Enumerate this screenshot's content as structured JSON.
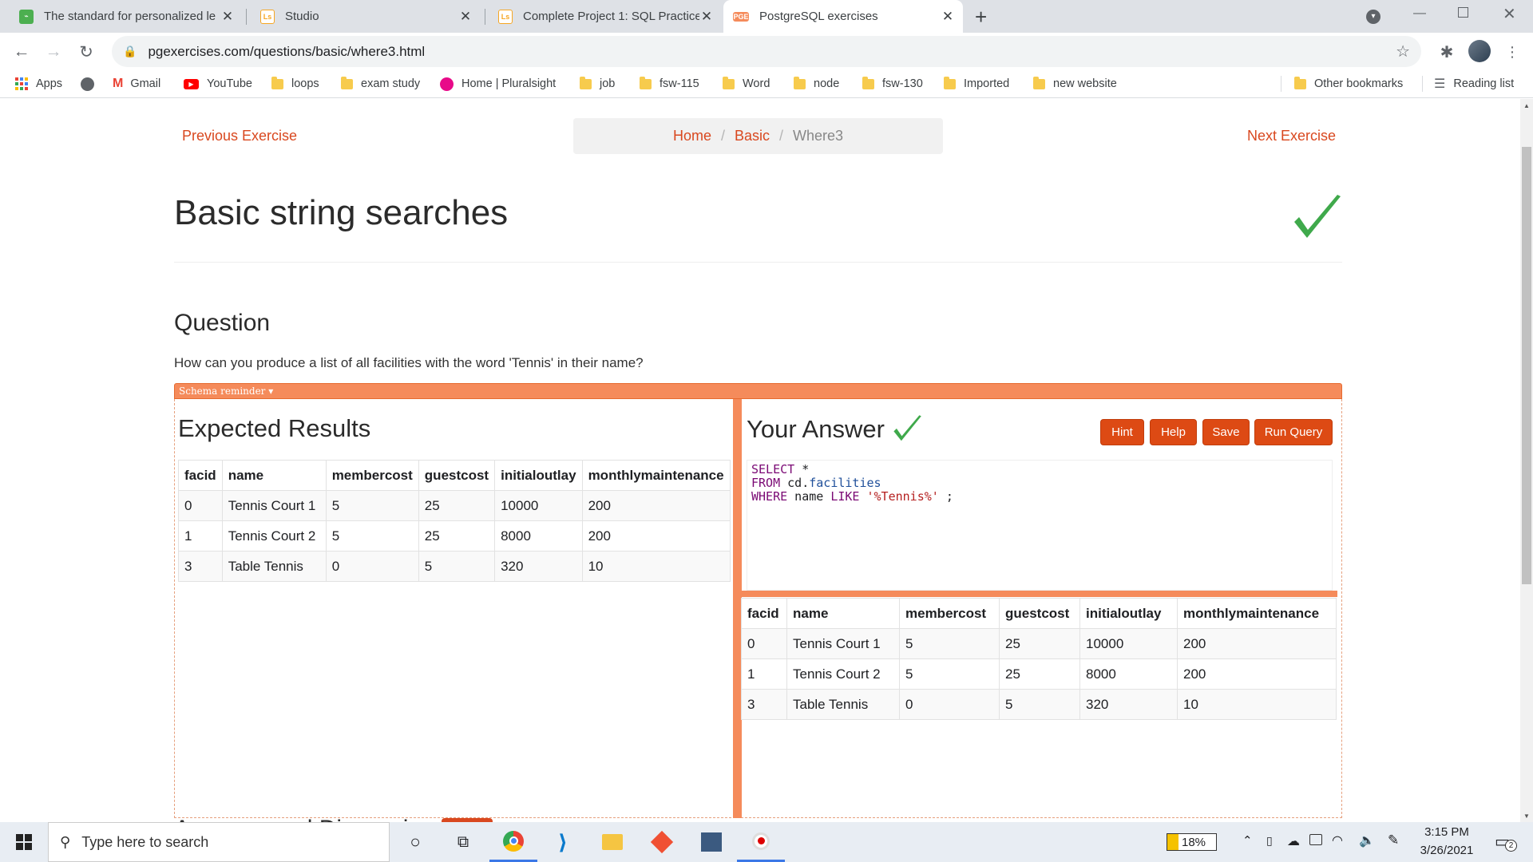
{
  "tabs": [
    {
      "title": "The standard for personalized le",
      "close": "✕",
      "favicon_color": "#4caf50"
    },
    {
      "title": "Studio",
      "close": "✕",
      "favicon_color": "#f6a623"
    },
    {
      "title": "Complete Project 1: SQL Practice",
      "close": "✕",
      "favicon_color": "#f6a623"
    },
    {
      "title": "PostgreSQL exercises",
      "close": "✕",
      "favicon_color": "#f58b5b"
    }
  ],
  "new_tab": "+",
  "url": "pgexercises.com/questions/basic/where3.html",
  "bookmarks": {
    "apps": "Apps",
    "gmail": "Gmail",
    "youtube": "YouTube",
    "loops": "loops",
    "exam_study": "exam study",
    "pluralsight": "Home | Pluralsight",
    "job": "job",
    "fsw115": "fsw-115",
    "word": "Word",
    "node": "node",
    "fsw130": "fsw-130",
    "imported": "Imported",
    "new_website": "new website",
    "other": "Other bookmarks",
    "reading_list": "Reading list"
  },
  "page": {
    "prev": "Previous Exercise",
    "next": "Next Exercise",
    "breadcrumb": {
      "home": "Home",
      "basic": "Basic",
      "current": "Where3",
      "sep": "/"
    },
    "title": "Basic string searches",
    "question_heading": "Question",
    "question_text": "How can you produce a list of all facilities with the word 'Tennis' in their name?",
    "schema_reminder": "Schema reminder ▾",
    "expected_heading": "Expected Results",
    "answer_heading": "Your Answer",
    "buttons": {
      "hint": "Hint",
      "help": "Help",
      "save": "Save",
      "run": "Run Query"
    },
    "query": {
      "line1_kw": "SELECT",
      "line1_rest": " *",
      "line2_kw": "FROM",
      "line2_rest": " cd.",
      "line2_obj": "facilities",
      "line3_kw": "WHERE",
      "line3_mid": " name ",
      "line3_kw2": "LIKE",
      "line3_str": " '%Tennis%'",
      "line3_end": " ;"
    },
    "bottom_heading_partial": "Answers and Discussion",
    "columns": [
      "facid",
      "name",
      "membercost",
      "guestcost",
      "initialoutlay",
      "monthlymaintenance"
    ],
    "rows": [
      [
        "0",
        "Tennis Court 1",
        "5",
        "25",
        "10000",
        "200"
      ],
      [
        "1",
        "Tennis Court 2",
        "5",
        "25",
        "8000",
        "200"
      ],
      [
        "3",
        "Table Tennis",
        "0",
        "5",
        "320",
        "10"
      ]
    ]
  },
  "taskbar": {
    "search_placeholder": "Type here to search",
    "battery": "18%",
    "time": "3:15 PM",
    "date": "3/26/2021",
    "notifications": "2"
  },
  "colors": {
    "accent": "#d9481f",
    "check": "#3fa94b",
    "divider": "#f58b5b"
  }
}
